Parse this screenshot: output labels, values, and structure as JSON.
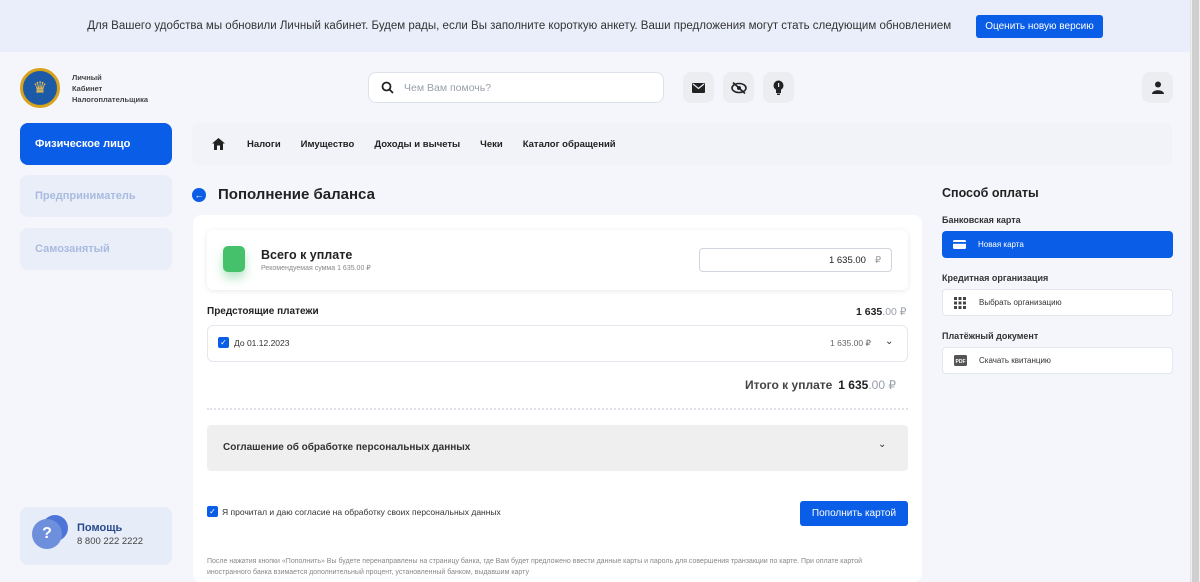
{
  "banner": {
    "text": "Для Вашего удобства мы обновили Личный кабинет. Будем рады, если Вы заполните короткую анкету. Ваши предложения могут стать следующим обновлением",
    "button": "Оценить новую версию"
  },
  "logo": {
    "line1": "Личный",
    "line2": "Кабинет",
    "line3": "Налогоплательщика"
  },
  "search": {
    "placeholder": "Чем Вам помочь?"
  },
  "header_icons": [
    "mail-icon",
    "eye-off-icon",
    "lightbulb-icon",
    "user-icon"
  ],
  "sidebar": {
    "items": [
      {
        "label": "Физическое лицо",
        "active": true
      },
      {
        "label": "Предприниматель",
        "active": false
      },
      {
        "label": "Самозанятый",
        "active": false
      }
    ]
  },
  "help": {
    "title": "Помощь",
    "phone": "8 800 222 2222"
  },
  "nav": {
    "items": [
      "Налоги",
      "Имущество",
      "Доходы и вычеты",
      "Чеки",
      "Каталог обращений"
    ]
  },
  "page": {
    "title": "Пополнение баланса"
  },
  "total": {
    "label": "Всего к уплате",
    "hint": "Рекомендуемая сумма 1 635.00 ₽",
    "amount": "1 635.00",
    "currency": "₽"
  },
  "upcoming": {
    "label": "Предстоящие платежи",
    "amount_int": "1 635",
    "amount_dec": ".00 ₽",
    "items": [
      {
        "label": "До 01.12.2023",
        "amount": "1 635.00 ₽",
        "checked": true
      }
    ]
  },
  "itogo": {
    "label": "Итого к уплате",
    "amount_int": "1 635",
    "amount_dec": ".00 ₽"
  },
  "agreement": {
    "title": "Соглашение об обработке персональных данных"
  },
  "consent": {
    "text": "Я прочитал и даю согласие на обработку своих персональных данных",
    "checked": true
  },
  "pay_button": "Пополнить картой",
  "footnote": "После нажатия кнопки «Пополнить» Вы будете перенаправлены на страницу банка, где Вам будет предложено ввести данные карты и пароль для совершения транзакции по карте. При оплате картой иностранного банка взимается дополнительный процент, установленный банком, выдавшим карту",
  "payment": {
    "title": "Способ оплаты",
    "groups": [
      {
        "label": "Банковская карта",
        "option": "Новая карта",
        "selected": true
      },
      {
        "label": "Кредитная организация",
        "option": "Выбрать организацию",
        "selected": false
      },
      {
        "label": "Платёжный документ",
        "option": "Скачать квитанцию",
        "selected": false
      }
    ]
  },
  "colors": {
    "accent": "#0a5de6",
    "green": "#46c16b"
  }
}
